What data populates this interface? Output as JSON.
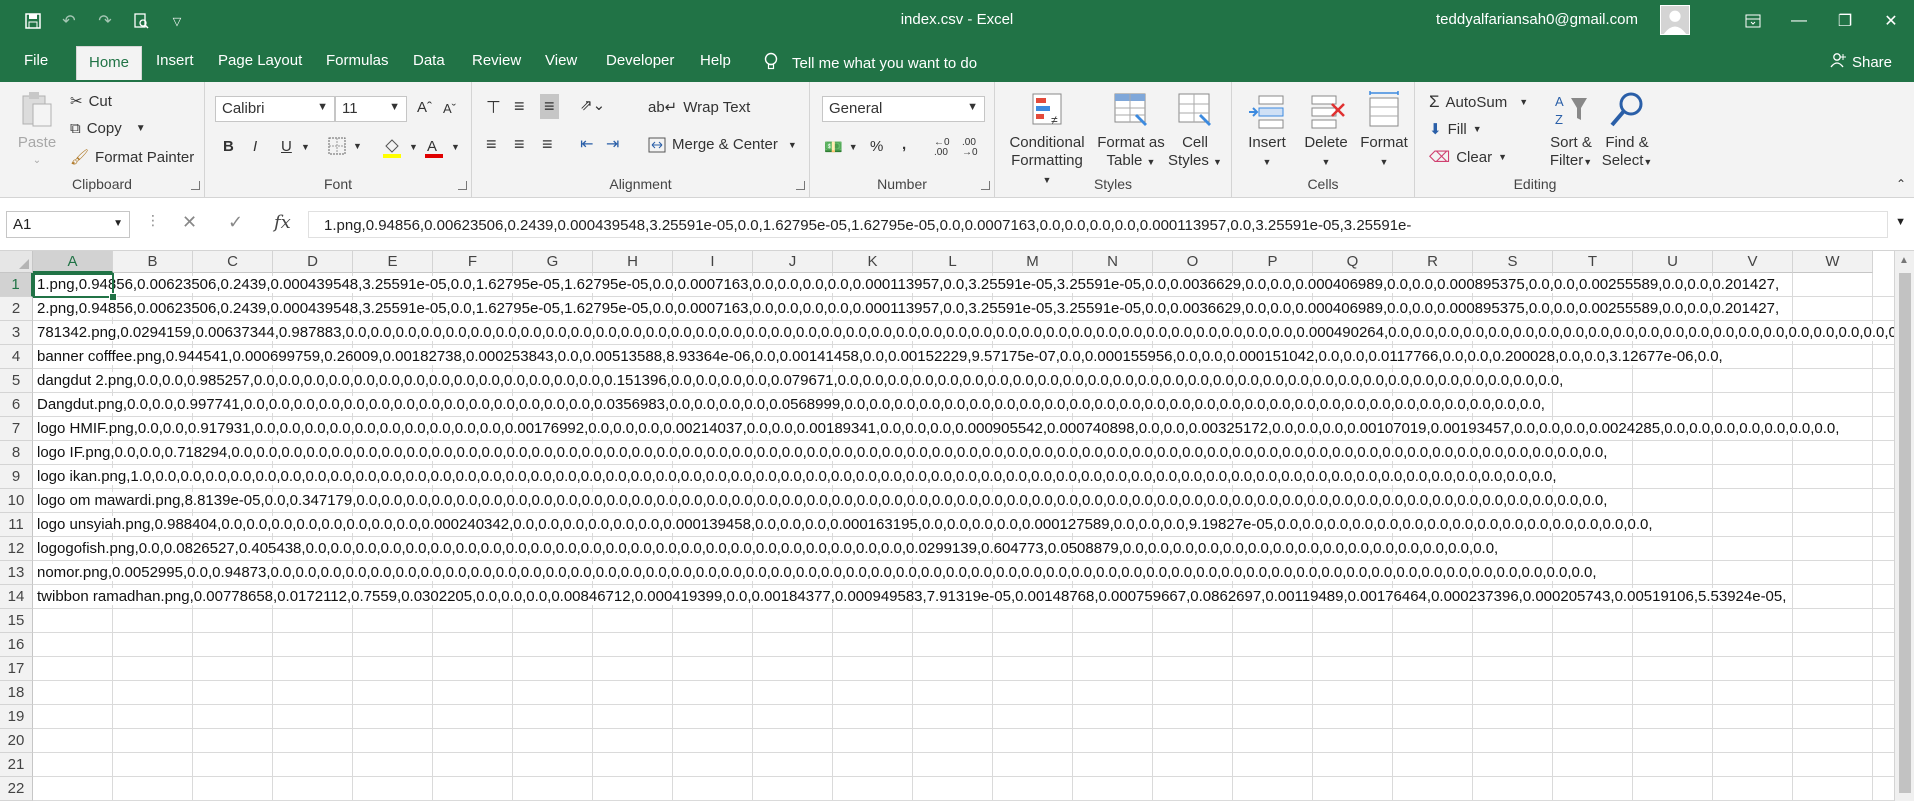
{
  "window": {
    "title": "index.csv - Excel",
    "user": "teddyalfariansah0@gmail.com"
  },
  "tabs": [
    "File",
    "Home",
    "Insert",
    "Page Layout",
    "Formulas",
    "Data",
    "Review",
    "View",
    "Developer",
    "Help"
  ],
  "tell_me": "Tell me what you want to do",
  "share": "Share",
  "ribbon": {
    "clipboard": {
      "label": "Clipboard",
      "paste": "Paste",
      "cut": "Cut",
      "copy": "Copy",
      "format_painter": "Format Painter"
    },
    "font": {
      "label": "Font",
      "name": "Calibri",
      "size": "11",
      "bold": "B",
      "italic": "I",
      "underline": "U"
    },
    "alignment": {
      "label": "Alignment",
      "wrap": "Wrap Text",
      "merge": "Merge & Center"
    },
    "number": {
      "label": "Number",
      "format": "General",
      "percent": "%",
      "comma": ","
    },
    "styles": {
      "label": "Styles",
      "conditional": "Conditional",
      "conditional2": "Formatting",
      "format_table": "Format as",
      "format_table2": "Table",
      "cell_styles": "Cell",
      "cell_styles2": "Styles"
    },
    "cells": {
      "label": "Cells",
      "insert": "Insert",
      "delete": "Delete",
      "format": "Format"
    },
    "editing": {
      "label": "Editing",
      "autosum": "AutoSum",
      "fill": "Fill",
      "clear": "Clear",
      "sort": "Sort &",
      "sort2": "Filter",
      "find": "Find &",
      "find2": "Select"
    }
  },
  "formula_bar": {
    "name_box": "A1",
    "formula": "1.png,0.94856,0.00623506,0.2439,0.000439548,3.25591e-05,0.0,1.62795e-05,1.62795e-05,0.0,0.0007163,0.0,0.0,0.0,0.0,0.000113957,0.0,3.25591e-05,3.25591e-"
  },
  "columns": [
    "A",
    "B",
    "C",
    "D",
    "E",
    "F",
    "G",
    "H",
    "I",
    "J",
    "K",
    "L",
    "M",
    "N",
    "O",
    "P",
    "Q",
    "R",
    "S",
    "T",
    "U",
    "V",
    "W"
  ],
  "row_numbers": [
    "1",
    "2",
    "3",
    "4",
    "5",
    "6",
    "7",
    "8",
    "9",
    "10",
    "11",
    "12",
    "13",
    "14",
    "15",
    "16",
    "17",
    "18",
    "19",
    "20",
    "21",
    "22"
  ],
  "rows": [
    "1.png,0.94856,0.00623506,0.2439,0.000439548,3.25591e-05,0.0,1.62795e-05,1.62795e-05,0.0,0.0007163,0.0,0.0,0.0,0.0,0.000113957,0.0,3.25591e-05,3.25591e-05,0.0,0.0036629,0.0,0.0,0.000406989,0.0,0.0,0.000895375,0.0,0.0,0.00255589,0.0,0.0,0.201427,",
    "2.png,0.94856,0.00623506,0.2439,0.000439548,3.25591e-05,0.0,1.62795e-05,1.62795e-05,0.0,0.0007163,0.0,0.0,0.0,0.0,0.000113957,0.0,3.25591e-05,3.25591e-05,0.0,0.0036629,0.0,0.0,0.000406989,0.0,0.0,0.000895375,0.0,0.0,0.00255589,0.0,0.0,0.201427,",
    "781342.png,0.0294159,0.00637344,0.987883,0.0,0.0,0.0,0.0,0.0,0.0,0.0,0.0,0.0,0.0,0.0,0.0,0.0,0.0,0.0,0.0,0.0,0.0,0.0,0.0,0.0,0.0,0.0,0.0,0.0,0.0,0.0,0.0,0.0,0.0,0.0,0.0,0.0,0.0,0.0,0.0,0.0,0.0,0.000490264,0.0,0.0,0.0,0.0,0.0,0.0,0.0,0.0,0.0,0.0,0.0,0.0,0.0,0.0,0.0,0.0,0.0,0.0,0.0,0.0,0.0,0.0,0.0,0.0,",
    "banner cofffee.png,0.944541,0.000699759,0.26009,0.00182738,0.000253843,0.0,0.00513588,8.93364e-06,0.0,0.00141458,0.0,0.00152229,9.57175e-07,0.0,0.000155956,0.0,0.0,0.000151042,0.0,0.0,0.0117766,0.0,0.0,0.200028,0.0,0.0,3.12677e-06,0.0,",
    "dangdut 2.png,0.0,0.0,0.985257,0.0,0.0,0.0,0.0,0.0,0.0,0.0,0.0,0.0,0.0,0.0,0.0,0.0,0.0,0.151396,0.0,0.0,0.0,0.0,0.079671,0.0,0.0,0.0,0.0,0.0,0.0,0.0,0.0,0.0,0.0,0.0,0.0,0.0,0.0,0.0,0.0,0.0,0.0,0.0,0.0,0.0,0.0,0.0,0.0,0.0,0.0,0.0,0.0,0.0,",
    "Dangdut.png,0.0,0.0,0.997741,0.0,0.0,0.0,0.0,0.0,0.0,0.0,0.0,0.0,0.0,0.0,0.0,0.0,0.0,0.0356983,0.0,0.0,0.0,0.0,0.0568999,0.0,0.0,0.0,0.0,0.0,0.0,0.0,0.0,0.0,0.0,0.0,0.0,0.0,0.0,0.0,0.0,0.0,0.0,0.0,0.0,0.0,0.0,0.0,0.0,0.0,0.0,0.0,0.0,",
    "logo HMIF.png,0.0,0.0,0.917931,0.0,0.0,0.0,0.0,0.0,0.0,0.0,0.0,0.0,0.0,0.00176992,0.0,0.0,0.0,0.00214037,0.0,0.0,0.00189341,0.0,0.0,0.0,0.000905542,0.000740898,0.0,0.0,0.00325172,0.0,0.0,0.0,0.00107019,0.00193457,0.0,0.0,0.0,0.0024285,0.0,0.0,0.0,0.0,0.0,0.0,0.0,",
    "logo IF.png,0.0,0.0,0.718294,0.0,0.0,0.0,0.0,0.0,0.0,0.0,0.0,0.0,0.0,0.0,0.0,0.0,0.0,0.0,0.0,0.0,0.0,0.0,0.0,0.0,0.0,0.0,0.0,0.0,0.0,0.0,0.0,0.0,0.0,0.0,0.0,0.0,0.0,0.0,0.0,0.0,0.0,0.0,0.0,0.0,0.0,0.0,0.0,0.0,0.0,0.0,0.0,0.0,0.0,0.0,0.0,0.0,0.0,0.0,",
    "logo ikan.png,1.0,0.0,0.0,0.0,0.0,0.0,0.0,0.0,0.0,0.0,0.0,0.0,0.0,0.0,0.0,0.0,0.0,0.0,0.0,0.0,0.0,0.0,0.0,0.0,0.0,0.0,0.0,0.0,0.0,0.0,0.0,0.0,0.0,0.0,0.0,0.0,0.0,0.0,0.0,0.0,0.0,0.0,0.0,0.0,0.0,0.0,0.0,0.0,0.0,0.0,0.0,0.0,0.0,0.0,0.0,0.0,0.0,",
    "logo om mawardi.png,8.8139e-05,0.0,0.347179,0.0,0.0,0.0,0.0,0.0,0.0,0.0,0.0,0.0,0.0,0.0,0.0,0.0,0.0,0.0,0.0,0.0,0.0,0.0,0.0,0.0,0.0,0.0,0.0,0.0,0.0,0.0,0.0,0.0,0.0,0.0,0.0,0.0,0.0,0.0,0.0,0.0,0.0,0.0,0.0,0.0,0.0,0.0,0.0,0.0,0.0,0.0,0.0,0.0,0.0,",
    "logo unsyiah.png,0.988404,0.0,0.0,0.0,0.0,0.0,0.0,0.0,0.0,0.000240342,0.0,0.0,0.0,0.0,0.0,0.0,0.000139458,0.0,0.0,0.0,0.000163195,0.0,0.0,0.0,0.0,0.000127589,0.0,0.0,0.0,9.19827e-05,0.0,0.0,0.0,0.0,0.0,0.0,0.0,0.0,0.0,0.0,0.0,0.0,0.0,0.0,0.0,",
    "logogofish.png,0.0,0.0826527,0.405438,0.0,0.0,0.0,0.0,0.0,0.0,0.0,0.0,0.0,0.0,0.0,0.0,0.0,0.0,0.0,0.0,0.0,0.0,0.0,0.0,0.0,0.0,0.0,0.0,0.0299139,0.604773,0.0508879,0.0,0.0,0.0,0.0,0.0,0.0,0.0,0.0,0.0,0.0,0.0,0.0,0.0,0.0,0.0,",
    "nomor.png,0.0052995,0.0,0.94873,0.0,0.0,0.0,0.0,0.0,0.0,0.0,0.0,0.0,0.0,0.0,0.0,0.0,0.0,0.0,0.0,0.0,0.0,0.0,0.0,0.0,0.0,0.0,0.0,0.0,0.0,0.0,0.0,0.0,0.0,0.0,0.0,0.0,0.0,0.0,0.0,0.0,0.0,0.0,0.0,0.0,0.0,0.0,0.0,0.0,0.0,0.0,0.0,0.0,0.0,0.0,0.0,0.0,",
    "twibbon ramadhan.png,0.00778658,0.0172112,0.7559,0.0302205,0.0,0.0,0.0,0.00846712,0.000419399,0.0,0.00184377,0.000949583,7.91319e-05,0.00148768,0.000759667,0.0862697,0.00119489,0.00176464,0.000237396,0.000205743,0.00519106,5.53924e-05,"
  ]
}
